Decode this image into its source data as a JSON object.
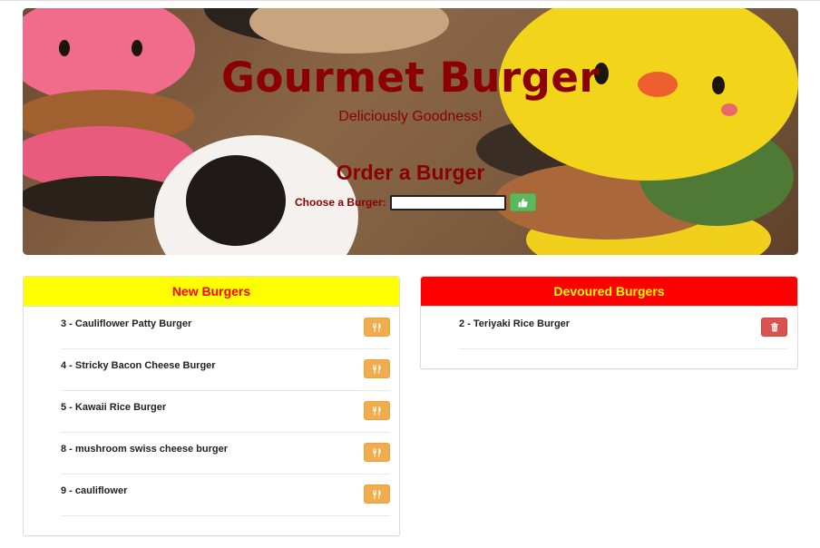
{
  "hero": {
    "title": "Gourmet Burger",
    "subtitle": "Deliciously Goodness!",
    "order_title": "Order a Burger",
    "order_label": "Choose a Burger:",
    "order_input_value": "",
    "submit_icon": "thumbs-up-icon"
  },
  "colors": {
    "title_text": "#8b0000",
    "new_panel_bg": "#ffff00",
    "new_panel_text": "#ff0000",
    "devoured_panel_bg": "#ff0000",
    "devoured_panel_text": "#ffff00",
    "eat_button": "#f0ad4e",
    "delete_button": "#d9534f",
    "submit_button": "#5cb85c"
  },
  "new_burgers": {
    "heading": "New Burgers",
    "action_icon": "utensils-icon",
    "items": [
      {
        "label": "3 - Cauliflower Patty Burger"
      },
      {
        "label": "4 - Stricky Bacon Cheese Burger"
      },
      {
        "label": "5 - Kawaii Rice Burger"
      },
      {
        "label": "8 - mushroom swiss cheese burger"
      },
      {
        "label": "9 - cauliflower"
      }
    ]
  },
  "devoured_burgers": {
    "heading": "Devoured Burgers",
    "action_icon": "trash-icon",
    "items": [
      {
        "label": "2 - Teriyaki Rice Burger"
      }
    ]
  }
}
